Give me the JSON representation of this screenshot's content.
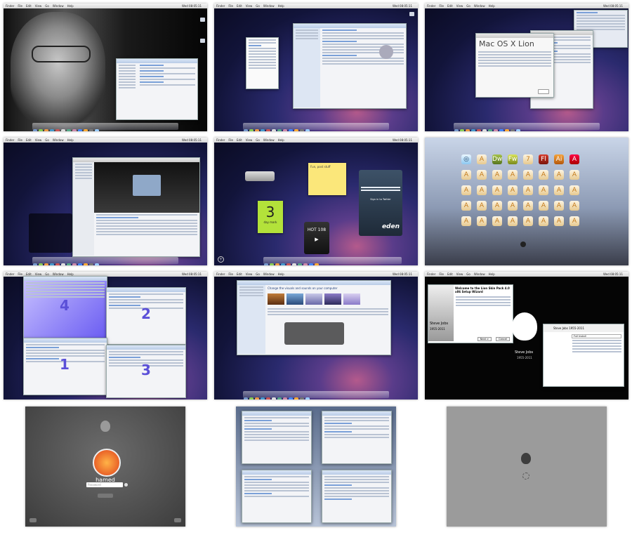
{
  "menu": [
    "Finder",
    "File",
    "Edit",
    "View",
    "Go",
    "Window",
    "Help"
  ],
  "clock": "Wed 08:05:11",
  "colors": {
    "space_dark": "#0a0b22",
    "space_mid": "#2a2a6e",
    "space_glow": "#b45a8c",
    "dock": "#c8c8d8",
    "login_bg": "#545454",
    "accent": "#5b50d8"
  },
  "tile3": {
    "title": "Mac OS X Lion"
  },
  "tile5": {
    "note": "Fun, post stuff",
    "cal_day": "3",
    "cal_month": "day mark",
    "radio": "HOT 108",
    "twitter_button": "Sign in to Twitter",
    "brand": "eden"
  },
  "tile7": {
    "numbers": [
      "4",
      "2",
      "1",
      "3"
    ]
  },
  "tile8": {
    "heading": "Change the visuals and sounds on your computer"
  },
  "tile9": {
    "welcome": "Welcome to the Lion Skin Pack 4.0 x86 Setup Wizard",
    "tribute_name": "Steve Jobs",
    "tribute_years": "1955-2011",
    "dialog_title": "Steve Jobs 1955-2011",
    "next_button": "Next >",
    "cancel_button": "Cancel",
    "components": "Full Install"
  },
  "tile10": {
    "user": "hamed",
    "password_placeholder": "Password"
  }
}
